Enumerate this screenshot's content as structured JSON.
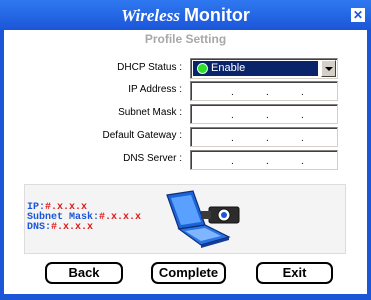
{
  "window": {
    "title_part1": "Wireless",
    "title_part2": "Monitor",
    "close_glyph": "✕"
  },
  "page": {
    "subtitle": "Profile Setting"
  },
  "fields": {
    "dhcp_label": "DHCP Status :",
    "dhcp_value": "Enable",
    "ip_label": "IP Address :",
    "subnet_label": "Subnet Mask :",
    "gateway_label": "Default Gateway :",
    "dns_label": "DNS Server :",
    "dot": "."
  },
  "info": {
    "ip_key": "IP:",
    "ip_val": "#.x.x.x",
    "subnet_key": "Subnet Mask:",
    "subnet_val": "#.x.x.x",
    "dns_key": "DNS:",
    "dns_val": "#.x.x.x"
  },
  "buttons": {
    "back": "Back",
    "complete": "Complete",
    "exit": "Exit"
  },
  "colors": {
    "accent": "#1b56d9",
    "info_value": "#e01818",
    "selection": "#0a246a",
    "led": "#2ee02e"
  },
  "icons": {
    "close": "close-icon",
    "dropdown": "chevron-down-icon",
    "status": "status-led-icon",
    "laptop": "laptop-icon"
  }
}
